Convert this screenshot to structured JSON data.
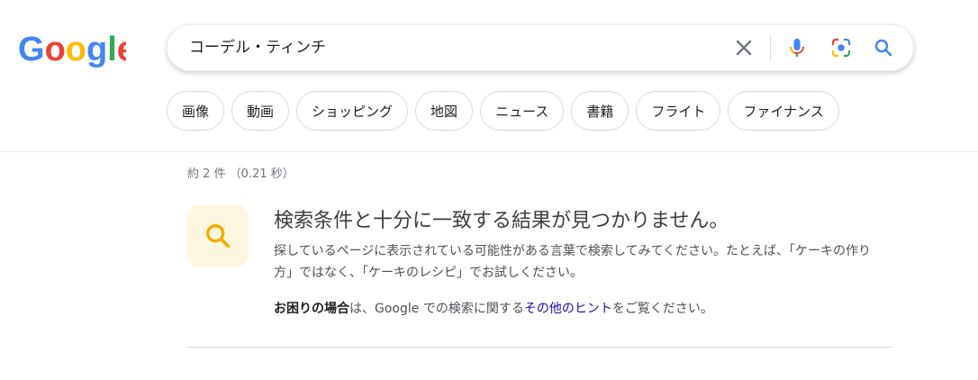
{
  "logo": {
    "text": "Google",
    "colors": [
      "#4285F4",
      "#EA4335",
      "#FBBC05",
      "#4285F4",
      "#34A853",
      "#EA4335"
    ]
  },
  "search": {
    "query": "コーデル・ティンチ"
  },
  "icons": {
    "clear": "close-icon",
    "voice": "microphone-icon",
    "lens": "camera-lens-icon",
    "submit": "search-icon",
    "notice": "search-icon"
  },
  "chips": [
    "画像",
    "動画",
    "ショッピング",
    "地図",
    "ニュース",
    "書籍",
    "フライト",
    "ファイナンス"
  ],
  "stats": "約 2 件 （0.21 秒）",
  "notice": {
    "title": "検索条件と十分に一致する結果が見つかりません。",
    "description": "探しているページに表示されている可能性がある言葉で検索してみてください。たとえば、「ケーキの作り方」ではなく、「ケーキのレシピ」でお試しください。",
    "help_bold": "お困りの場合",
    "help_middle": "は、Google での検索に関する",
    "help_link": "その他のヒント",
    "help_end": "をご覧ください。"
  },
  "colors": {
    "link": "#1a0dab",
    "notice_icon_bg": "#fef7e0",
    "notice_icon": "#F9AB00",
    "search_blue": "#4285F4"
  }
}
